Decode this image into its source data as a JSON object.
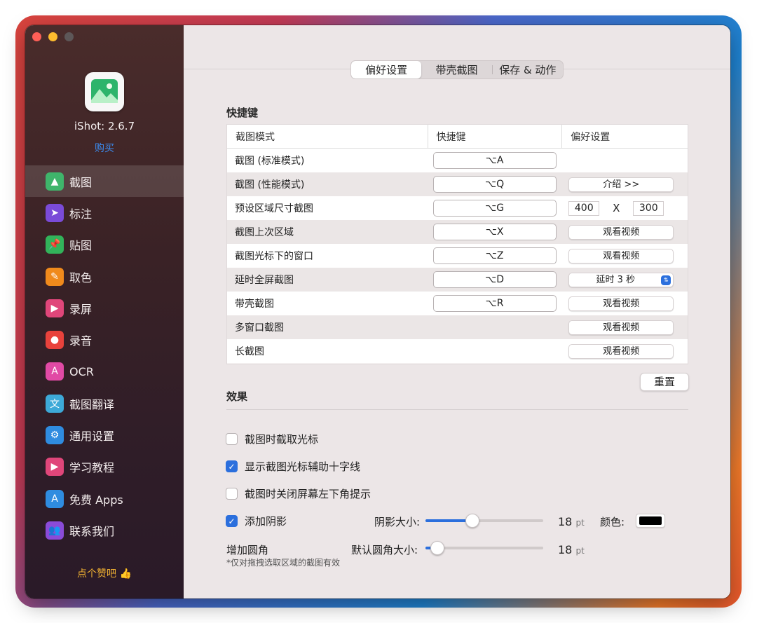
{
  "app": {
    "version": "iShot: 2.6.7",
    "buy": "购买",
    "like": "点个赞吧 👍"
  },
  "sidebar": {
    "items": [
      {
        "label": "截图",
        "icon": "screenshot-icon",
        "color": "#3fb56b",
        "glyph": "▲"
      },
      {
        "label": "标注",
        "icon": "cursor-icon",
        "color": "#7a4bd8",
        "glyph": "➤"
      },
      {
        "label": "贴图",
        "icon": "pin-icon",
        "color": "#32b35a",
        "glyph": "📌"
      },
      {
        "label": "取色",
        "icon": "color-picker-icon",
        "color": "#f08a1c",
        "glyph": "✎"
      },
      {
        "label": "录屏",
        "icon": "screen-record-icon",
        "color": "#e0467a",
        "glyph": "▶"
      },
      {
        "label": "录音",
        "icon": "microphone-icon",
        "color": "#e8423c",
        "glyph": "●"
      },
      {
        "label": "OCR",
        "icon": "ocr-icon",
        "color": "#e14aa5",
        "glyph": "A"
      },
      {
        "label": "截图翻译",
        "icon": "translate-icon",
        "color": "#3da9d8",
        "glyph": "文"
      },
      {
        "label": "通用设置",
        "icon": "settings-icon",
        "color": "#2f8ce0",
        "glyph": "⚙"
      },
      {
        "label": "学习教程",
        "icon": "tutorial-icon",
        "color": "#e0467a",
        "glyph": "▶"
      },
      {
        "label": "免费 Apps",
        "icon": "app-store-icon",
        "color": "#2f8ce0",
        "glyph": "A"
      },
      {
        "label": "联系我们",
        "icon": "contact-icon",
        "color": "#8a4bd8",
        "glyph": "👥"
      }
    ]
  },
  "tabs": [
    {
      "label": "偏好设置"
    },
    {
      "label": "带壳截图"
    },
    {
      "label": "保存 & 动作"
    }
  ],
  "shortcuts": {
    "title": "快捷键",
    "headers": [
      "截图模式",
      "快捷键",
      "偏好设置"
    ],
    "rows": [
      {
        "mode": "截图 (标准模式)",
        "key": "⌥A"
      },
      {
        "mode": "截图 (性能模式)",
        "key": "⌥Q",
        "action": "介绍 >>"
      },
      {
        "mode": "预设区域尺寸截图",
        "key": "⌥G",
        "w": "400",
        "x": "X",
        "h": "300"
      },
      {
        "mode": "截图上次区域",
        "key": "⌥X",
        "action": "观看视频"
      },
      {
        "mode": "截图光标下的窗口",
        "key": "⌥Z",
        "action": "观看视频"
      },
      {
        "mode": "延时全屏截图",
        "key": "⌥D",
        "select": "延时 3 秒"
      },
      {
        "mode": "带壳截图",
        "key": "⌥R",
        "action": "观看视频"
      },
      {
        "mode": "多窗口截图",
        "action": "观看视频"
      },
      {
        "mode": "长截图",
        "action": "观看视频"
      }
    ],
    "reset": "重置"
  },
  "effects": {
    "title": "效果",
    "capture_cursor": {
      "label": "截图时截取光标",
      "checked": false
    },
    "crosshair": {
      "label": "显示截图光标辅助十字线",
      "checked": true
    },
    "close_hint": {
      "label": "截图时关闭屏幕左下角提示",
      "checked": false
    },
    "shadow": {
      "label": "添加阴影",
      "checked": true,
      "size_label": "阴影大小:",
      "value": "18",
      "unit": "pt",
      "level": 0.4,
      "color_label": "颜色:",
      "color": "#000000"
    },
    "corner": {
      "label": "增加圆角",
      "size_label": "默认圆角大小:",
      "value": "18",
      "unit": "pt",
      "level": 0.1,
      "note": "*仅对拖拽选取区域的截图有效"
    }
  },
  "colors": {
    "accent": "#2b6fdd",
    "link": "#3c8cf0"
  }
}
